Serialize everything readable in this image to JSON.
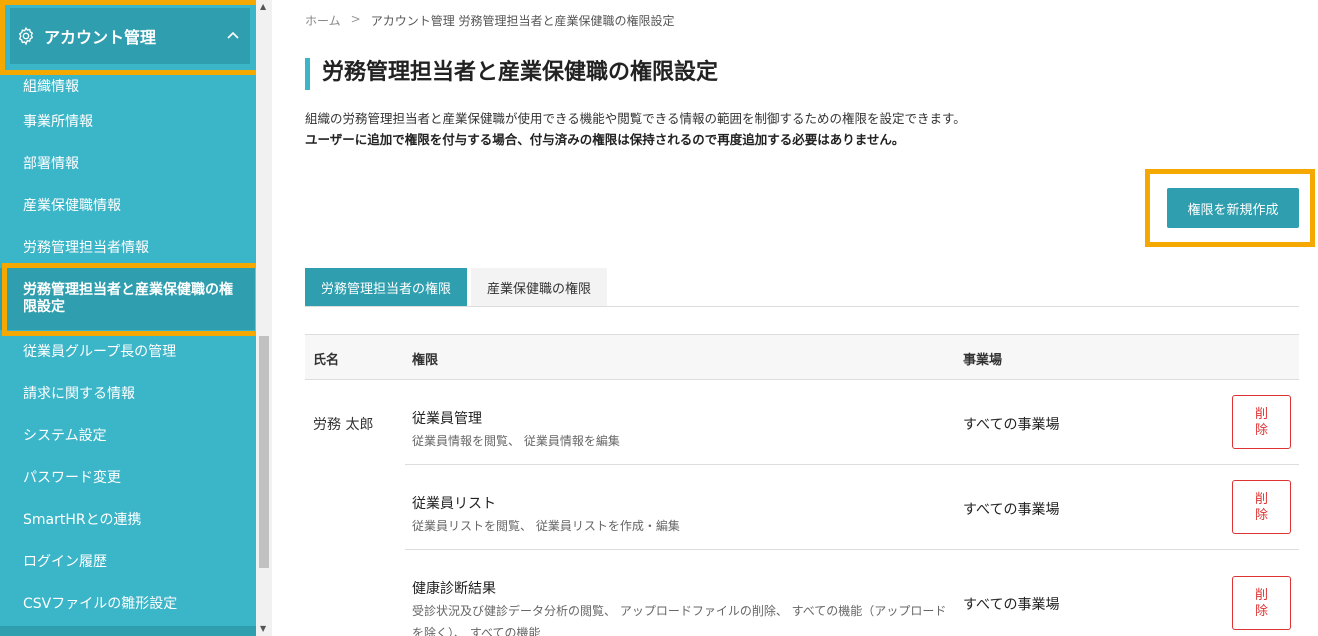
{
  "sidebar": {
    "header_title": "アカウント管理",
    "items": [
      {
        "label": "組織情報"
      },
      {
        "label": "事業所情報"
      },
      {
        "label": "部署情報"
      },
      {
        "label": "産業保健職情報"
      },
      {
        "label": "労務管理担当者情報"
      },
      {
        "label": "労務管理担当者と産業保健職の権限設定"
      },
      {
        "label": "従業員グループ長の管理"
      },
      {
        "label": "請求に関する情報"
      },
      {
        "label": "システム設定"
      },
      {
        "label": "パスワード変更"
      },
      {
        "label": "SmartHRとの連携"
      },
      {
        "label": "ログイン履歴"
      },
      {
        "label": "CSVファイルの雛形設定"
      }
    ]
  },
  "breadcrumb": {
    "home": "ホーム",
    "separator": ">",
    "current": "アカウント管理 労務管理担当者と産業保健職の権限設定"
  },
  "page": {
    "title": "労務管理担当者と産業保健職の権限設定",
    "description": "組織の労務管理担当者と産業保健職が使用できる機能や閲覧できる情報の範囲を制御するための権限を設定できます。",
    "note": "ユーザーに追加で権限を付与する場合、付与済みの権限は保持されるので再度追加する必要はありません。",
    "create_button": "権限を新規作成"
  },
  "tabs": [
    {
      "label": "労務管理担当者の権限",
      "active": true
    },
    {
      "label": "産業保健職の権限",
      "active": false
    }
  ],
  "table": {
    "headers": {
      "name": "氏名",
      "permission": "権限",
      "site": "事業場"
    },
    "user_name": "労務 太郎",
    "rows": [
      {
        "permission": "従業員管理",
        "detail": "従業員情報を閲覧、 従業員情報を編集",
        "site": "すべての事業場",
        "delete_label": "削除"
      },
      {
        "permission": "従業員リスト",
        "detail": "従業員リストを閲覧、 従業員リストを作成・編集",
        "site": "すべての事業場",
        "delete_label": "削除"
      },
      {
        "permission": "健康診断結果",
        "detail": "受診状況及び健診データ分析の閲覧、 アップロードファイルの削除、 すべての機能（アップロードを除く）、 すべての機能",
        "site": "すべての事業場",
        "delete_label": "削除"
      }
    ]
  },
  "colors": {
    "sidebar": "#3bb5c8",
    "accent": "#2f9eae",
    "highlight": "#f5a800",
    "danger": "#dd3333"
  }
}
